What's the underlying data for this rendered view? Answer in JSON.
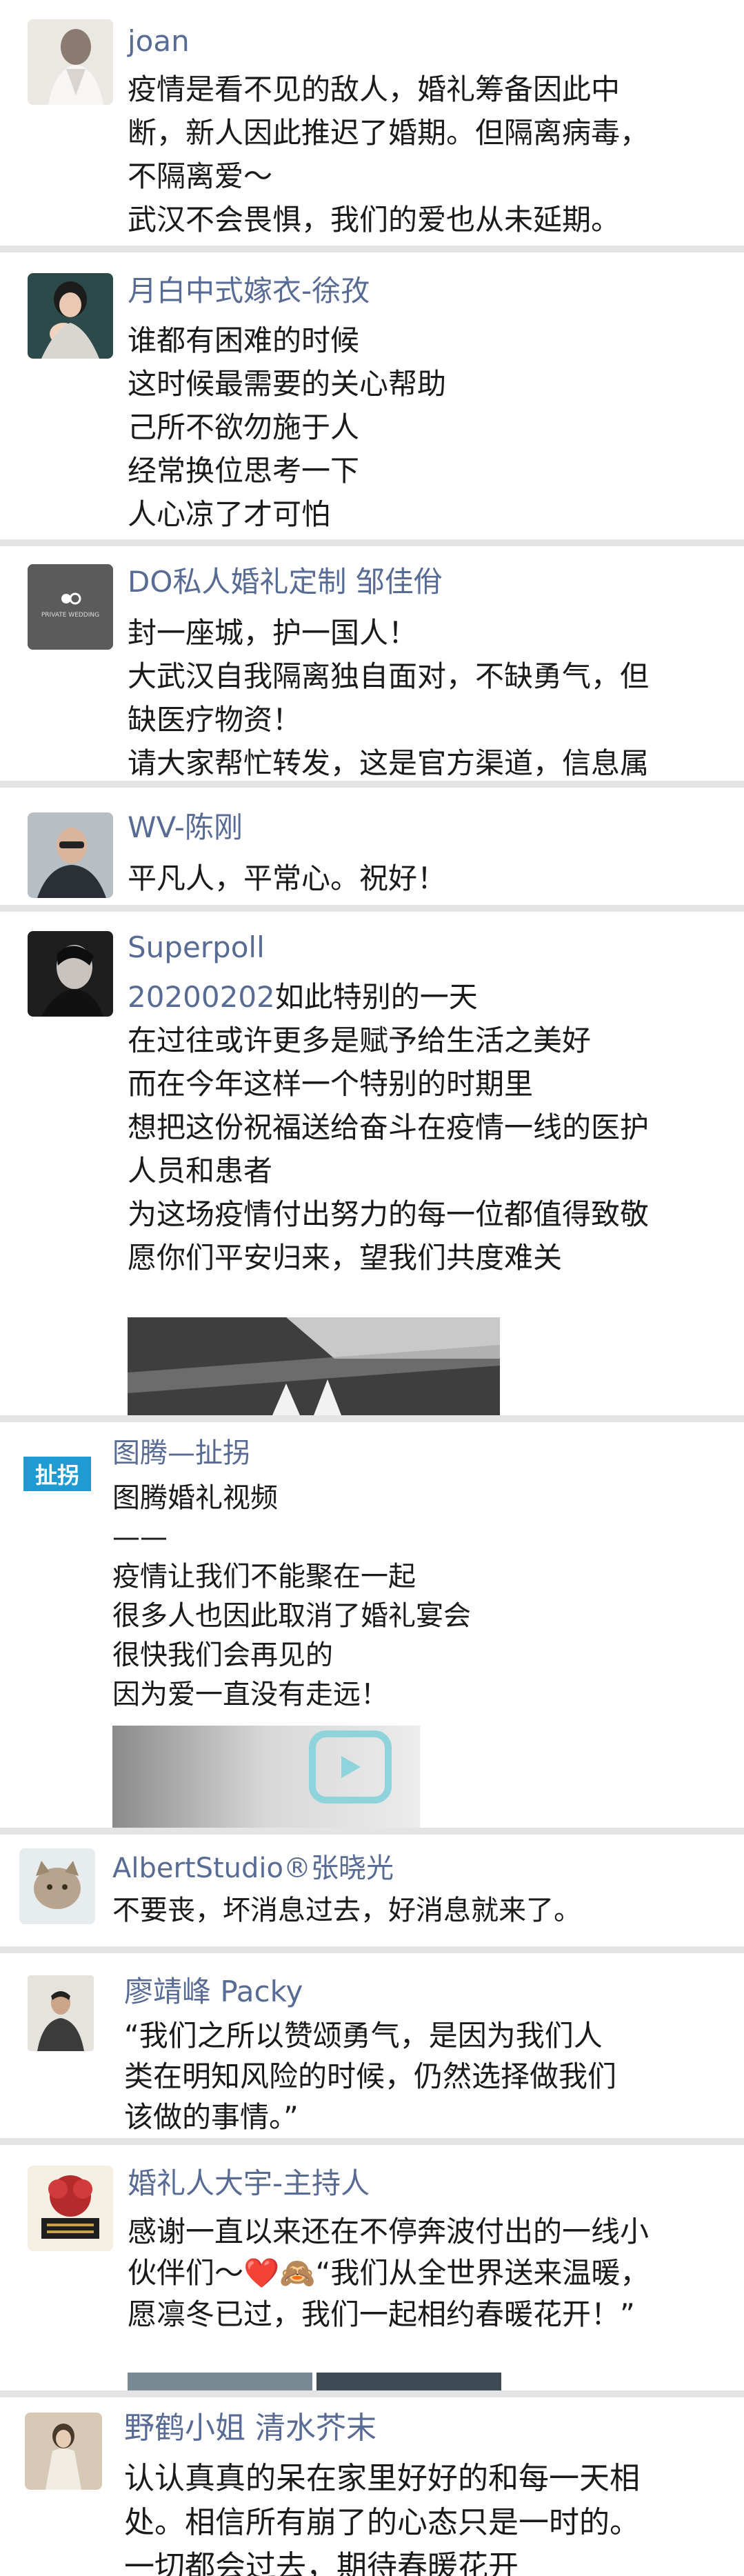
{
  "colors": {
    "name": "#586b95",
    "text": "#1a1a1a",
    "separator": "#e4e4e4",
    "card": "#ffffff"
  },
  "posts": [
    {
      "name": "joan",
      "lines": [
        "疫情是看不见的敌人，婚礼筹备因此中",
        "断，新人因此推迟了婚期。但隔离病毒，",
        "不隔离爱～",
        "武汉不会畏惧，我们的爱也从未延期。"
      ]
    },
    {
      "name": "月白中式嫁衣-徐孜",
      "lines": [
        "谁都有困难的时候",
        "这时候最需要的关心帮助",
        "己所不欲勿施于人",
        "经常换位思考一下",
        "人心凉了才可怕"
      ]
    },
    {
      "name": "DO私人婚礼定制 邹佳佾",
      "avatar_text": "PRIVATE WEDDING",
      "lines": [
        "封一座城，护一国人！",
        "大武汉自我隔离独自面对，不缺勇气，但",
        "缺医疗物资！",
        "请大家帮忙转发，这是官方渠道，信息属"
      ]
    },
    {
      "name": "WV-陈刚",
      "lines": [
        "平凡人，平常心。祝好！"
      ]
    },
    {
      "name": "Superpoll",
      "date": "20200202",
      "lines": [
        "如此特别的一天",
        "在过往或许更多是赋予给生活之美好",
        "而在今年这样一个特别的时期里",
        "想把这份祝福送给奋斗在疫情一线的医护",
        "人员和患者",
        "为这场疫情付出努力的每一位都值得致敬",
        "愿你们平安归来，望我们共度难关"
      ]
    },
    {
      "name": "图腾—扯拐",
      "avatar_text": "扯拐",
      "lines": [
        "图腾婚礼视频",
        "——",
        "疫情让我们不能聚在一起",
        "很多人也因此取消了婚礼宴会",
        "很快我们会再见的",
        "因为爱一直没有走远！"
      ]
    },
    {
      "name": "AlbertStudio®张晓光",
      "lines": [
        "不要丧，坏消息过去，好消息就来了。"
      ]
    },
    {
      "name": "廖靖峰 Packy",
      "lines": [
        "“我们之所以赞颂勇气，是因为我们人",
        "类在明知风险的时候，仍然选择做我们",
        "该做的事情。”"
      ]
    },
    {
      "name": "婚礼人大宇-主持人",
      "lines": [
        "感谢一直以来还在不停奔波付出的一线小",
        "伙伴们～❤️🙈“我们从全世界送来温暖，",
        "愿凛冬已过，我们一起相约春暖花开！”"
      ]
    },
    {
      "name": "野鹤小姐 清水芥末",
      "lines": [
        "认认真真的呆在家里好好的和每一天相",
        "处。相信所有崩了的心态只是一时的。",
        "一切都会过去，期待春暖花开"
      ]
    }
  ]
}
